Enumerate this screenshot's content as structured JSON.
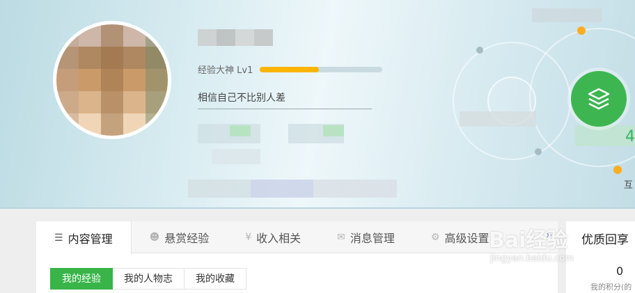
{
  "profile": {
    "level_label": "经验大神 Lv1",
    "level_progress": 0.48,
    "motto": "相信自己不比别人差"
  },
  "header_right": {
    "digit": "4",
    "hudong_label": "互"
  },
  "tabs": [
    {
      "label": "内容管理",
      "icon": "list-icon",
      "glyph": "☰",
      "active": true
    },
    {
      "label": "悬赏经验",
      "icon": "reward-icon",
      "glyph": "☻",
      "active": false
    },
    {
      "label": "收入相关",
      "icon": "yen-icon",
      "glyph": "¥",
      "active": false
    },
    {
      "label": "消息管理",
      "icon": "mail-icon",
      "glyph": "✉",
      "active": false
    },
    {
      "label": "高级设置",
      "icon": "gear-icon",
      "glyph": "⚙",
      "active": false
    }
  ],
  "tab_more": "»",
  "subtabs": [
    {
      "label": "我的经验",
      "active": true
    },
    {
      "label": "我的人物志",
      "active": false
    },
    {
      "label": "我的收藏",
      "active": false
    }
  ],
  "side_card": {
    "title": "优质回享",
    "value": "0",
    "label": "我的积分(的"
  },
  "watermark": {
    "logo": "Bai经验",
    "url": "jingyan.baidu.com"
  },
  "colors": {
    "accent_green": "#38b449",
    "progress_orange": "#ffb400",
    "link_blue": "#3a66c4"
  }
}
